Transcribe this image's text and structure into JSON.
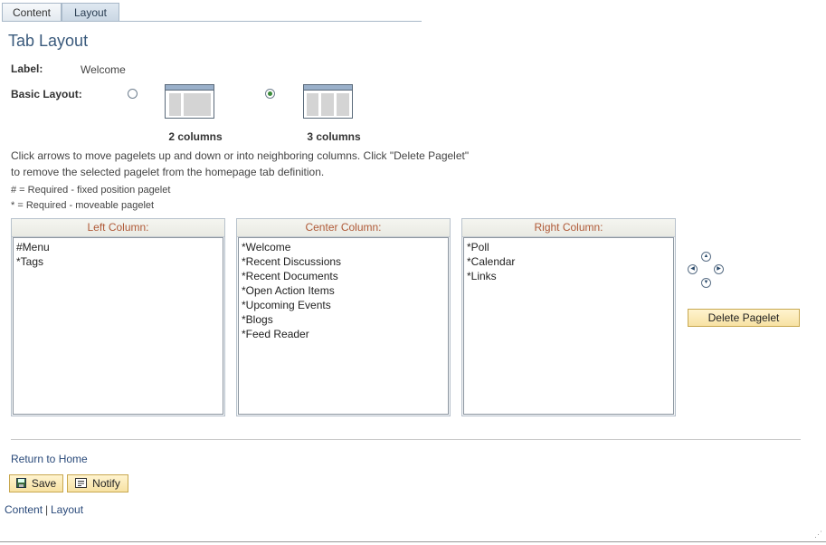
{
  "tabs": [
    {
      "label": "Content",
      "active": false
    },
    {
      "label": "Layout",
      "active": true
    }
  ],
  "page_title": "Tab Layout",
  "label_field": {
    "label": "Label:",
    "value": "Welcome"
  },
  "basic_layout": {
    "label": "Basic Layout:",
    "options": [
      {
        "caption": "2 columns",
        "selected": false
      },
      {
        "caption": "3 columns",
        "selected": true
      }
    ]
  },
  "instructions": {
    "line1": "Click arrows to move pagelets up and down or into neighboring columns. Click \"Delete Pagelet\"",
    "line2": "to remove the selected pagelet from the homepage tab definition."
  },
  "notes": {
    "fixed": "# = Required - fixed position pagelet",
    "moveable": "* = Required - moveable pagelet"
  },
  "columns": {
    "left": {
      "header": "Left Column:",
      "items": [
        "#Menu",
        "*Tags"
      ]
    },
    "center": {
      "header": "Center Column:",
      "items": [
        "*Welcome",
        "*Recent Discussions",
        "*Recent Documents",
        "*Open Action Items",
        "*Upcoming Events",
        "*Blogs",
        "*Feed Reader"
      ]
    },
    "right": {
      "header": "Right Column:",
      "items": [
        "*Poll",
        "*Calendar",
        "*Links"
      ]
    }
  },
  "arrow_icons": {
    "up": "arrow-up-icon",
    "down": "arrow-down-icon",
    "left": "arrow-left-icon",
    "right": "arrow-right-icon"
  },
  "delete_button": "Delete Pagelet",
  "return_link": "Return to Home",
  "save_button": "Save",
  "notify_button": "Notify",
  "footer_links": {
    "content": "Content",
    "separator": "|",
    "layout": "Layout"
  },
  "colors": {
    "title": "#3a5a7c",
    "column_header": "#b05a38",
    "button_bg": "#f7e2a3"
  }
}
